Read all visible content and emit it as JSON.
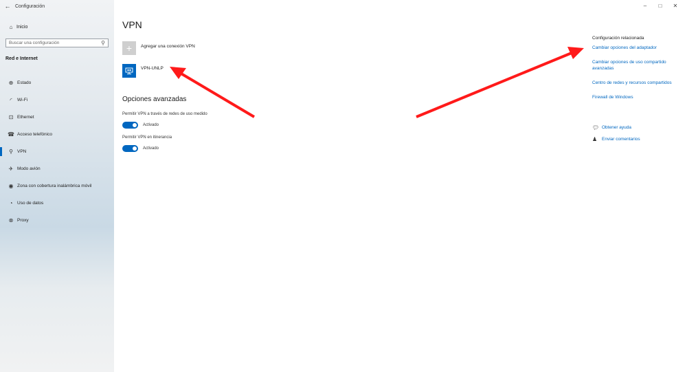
{
  "window": {
    "title": "Configuración",
    "controls": {
      "minimize": "–",
      "maximize": "□",
      "close": "✕"
    }
  },
  "sidebar": {
    "home_label": "Inicio",
    "search_placeholder": "Buscar una configuración",
    "section_title": "Red e Internet",
    "items": [
      {
        "label": "Estado",
        "icon": "globe-icon",
        "glyph": "⊕",
        "active": false
      },
      {
        "label": "Wi-Fi",
        "icon": "wifi-icon",
        "glyph": "◜",
        "active": false
      },
      {
        "label": "Ethernet",
        "icon": "ethernet-icon",
        "glyph": "⊡",
        "active": false
      },
      {
        "label": "Acceso telefónico",
        "icon": "dialup-icon",
        "glyph": "☎",
        "active": false
      },
      {
        "label": "VPN",
        "icon": "vpn-icon",
        "glyph": "⚲",
        "active": true
      },
      {
        "label": "Modo avión",
        "icon": "airplane-icon",
        "glyph": "✈",
        "active": false
      },
      {
        "label": "Zona con cobertura inalámbrica móvil",
        "icon": "hotspot-icon",
        "glyph": "◉",
        "active": false
      },
      {
        "label": "Uso de datos",
        "icon": "data-usage-icon",
        "glyph": "◔",
        "active": false
      },
      {
        "label": "Proxy",
        "icon": "proxy-icon",
        "glyph": "⊗",
        "active": false
      }
    ]
  },
  "main": {
    "title": "VPN",
    "add_vpn_label": "Agregar una conexión VPN",
    "vpn_connection_name": "VPN-UNLP",
    "advanced_title": "Opciones avanzadas",
    "options": [
      {
        "label": "Permitir VPN a través de redes de uso medido",
        "state": "Activado",
        "on": true
      },
      {
        "label": "Permitir VPN en itinerancia",
        "state": "Activado",
        "on": true
      }
    ]
  },
  "related": {
    "title": "Configuración relacionada",
    "links": [
      "Cambiar opciones del adaptador",
      "Cambiar opciones de uso compartido avanzadas",
      "Centro de redes y recursos compartidos",
      "Firewall de Windows"
    ]
  },
  "help": {
    "get_help": "Obtener ayuda",
    "feedback": "Enviar comentarios"
  },
  "annotations": {
    "arrow_color": "#ff1a1a"
  },
  "colors": {
    "accent": "#0067c0",
    "link": "#0067c0"
  }
}
